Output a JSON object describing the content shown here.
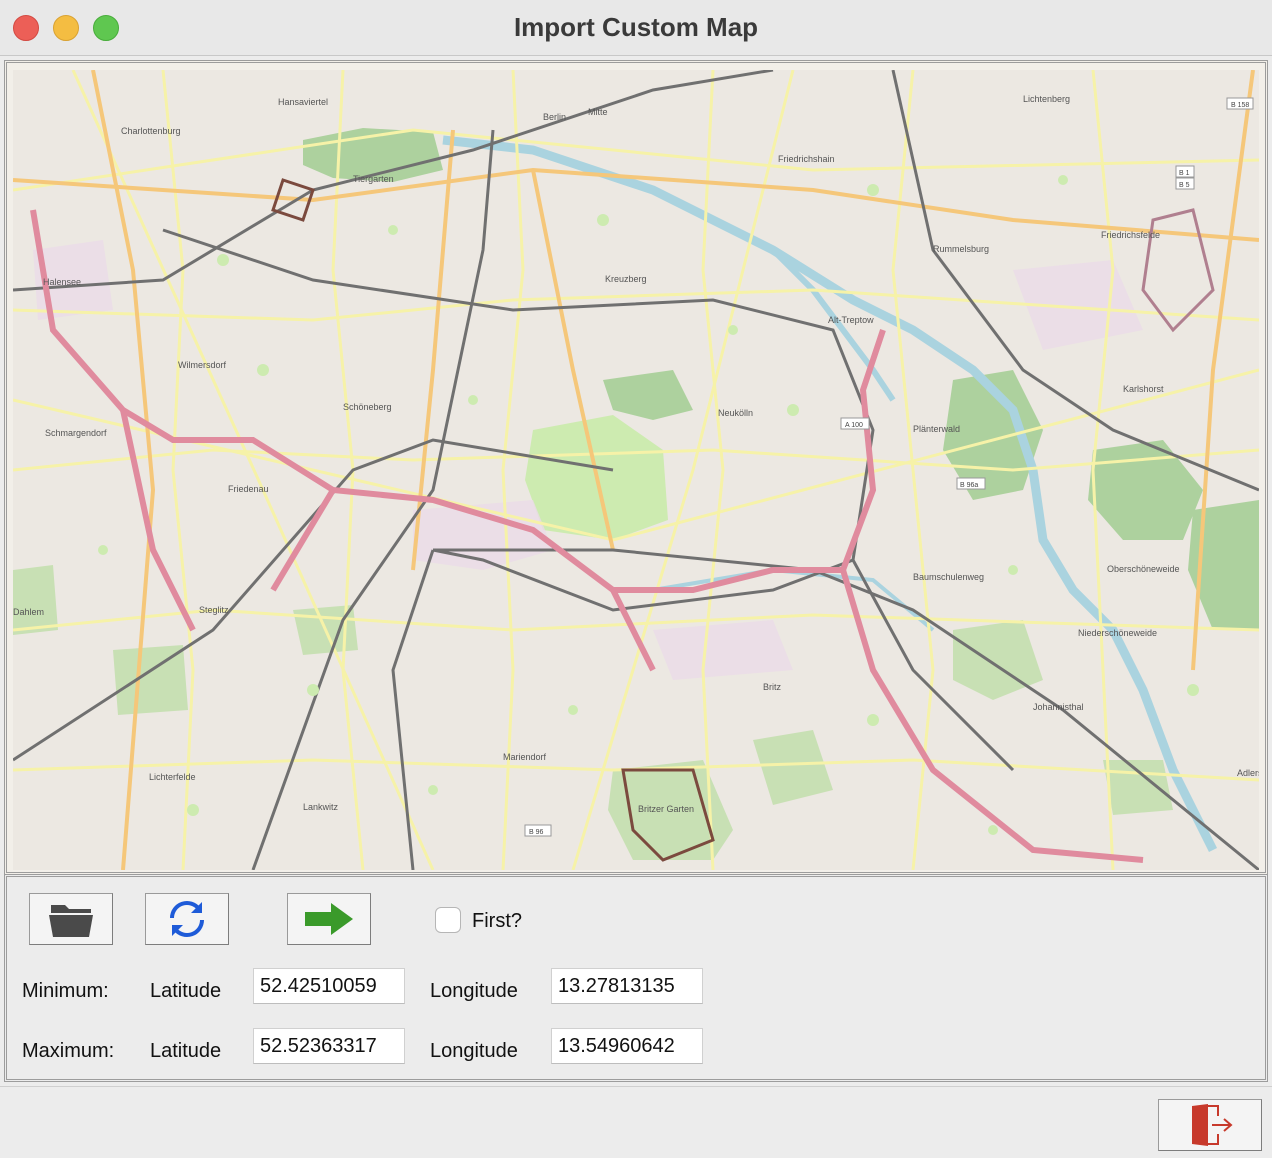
{
  "window": {
    "title": "Import Custom Map"
  },
  "map": {
    "places": [
      "Berlin",
      "Mitte",
      "Charlottenburg",
      "Hansaviertel",
      "Tiergarten",
      "Lichtenberg",
      "Friedrichshain",
      "Friedrichsfelde",
      "Rummelsburg",
      "Kreuzberg",
      "Alt-Treptow",
      "Wilmersdorf",
      "Schöneberg",
      "Neukölln",
      "Plänterwald",
      "Karlshorst",
      "Schmargendorf",
      "Friedenau",
      "Baumschulenweg",
      "Oberschöneweide",
      "Steglitz",
      "Niederschöneweide",
      "Britz",
      "Johannisthal",
      "Lichterfelde",
      "Mariendorf",
      "Lankwitz",
      "Halensee",
      "Dahlem",
      "Adlershof",
      "Britzer Garten"
    ],
    "road_shields": [
      "B 158",
      "B 1",
      "B 5",
      "B 96a",
      "A 100",
      "B 96"
    ]
  },
  "controls": {
    "open_icon": "folder-icon",
    "refresh_icon": "refresh-icon",
    "next_icon": "arrow-right-icon",
    "first_label": "First?",
    "first_checked": false,
    "minimum_label": "Minimum:",
    "maximum_label": "Maximum:",
    "latitude_label": "Latitude",
    "longitude_label": "Longitude",
    "min_latitude": "52.42510059",
    "min_longitude": "13.27813135",
    "max_latitude": "52.52363317",
    "max_longitude": "13.54960642"
  },
  "footer": {
    "exit_icon": "exit-door-icon"
  },
  "colors": {
    "accent_green": "#3a9a2a",
    "refresh_blue": "#1e5bd8",
    "exit_red": "#c7392b"
  }
}
